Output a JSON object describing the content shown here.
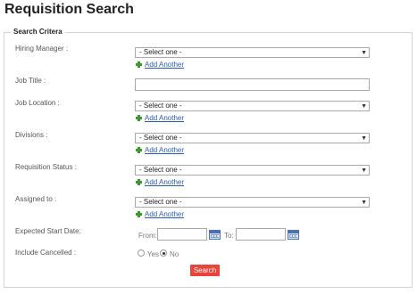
{
  "page_title": "Requisition Search",
  "legend": "Search Critera",
  "add_another": "Add Another",
  "hiring_manager": {
    "label": "Hiring Manager :",
    "value": "- Select one -"
  },
  "job_title": {
    "label": "Job Title :",
    "value": ""
  },
  "job_location": {
    "label": "Job Location :",
    "value": "- Select one -"
  },
  "divisions": {
    "label": "Divisions :",
    "value": "- Select one -"
  },
  "requisition_status": {
    "label": "Requisition Status :",
    "value": "- Select one -"
  },
  "assigned_to": {
    "label": "Assigned to :",
    "value": "- Select one -"
  },
  "expected_start_date": {
    "label": "Expected Start Date:",
    "from_label": "From:",
    "to_label": "To:",
    "from_value": "",
    "to_value": ""
  },
  "include_cancelled": {
    "label": "Include Cancelled :",
    "yes_label": "Yes",
    "no_label": "No",
    "selected": "No"
  },
  "search_button": "Search",
  "icons": {
    "add": "plus-icon",
    "calendar": "calendar-icon",
    "dropdown": "chevron-down-icon"
  },
  "colors": {
    "search_button": "#e8443a",
    "link": "#2a5db0",
    "add_icon": "#3a9a2a"
  }
}
